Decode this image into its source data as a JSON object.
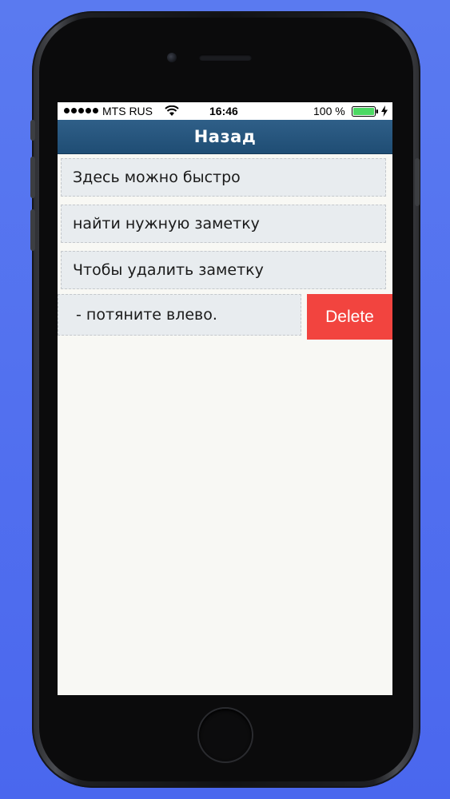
{
  "status_bar": {
    "carrier": "MTS RUS",
    "time": "16:46",
    "battery_percent": "100 %",
    "battery_level": 1.0,
    "icons": [
      "signal-dots-icon",
      "wifi-icon",
      "battery-icon",
      "charging-bolt-icon"
    ]
  },
  "nav": {
    "title": "Назад"
  },
  "notes": [
    {
      "text": "Здесь можно быстро"
    },
    {
      "text": "найти нужную заметку"
    },
    {
      "text": "Чтобы удалить заметку"
    },
    {
      "text": "- потяните влево."
    }
  ],
  "swipe": {
    "delete_label": "Delete"
  },
  "colors": {
    "background": "#4a67ee",
    "nav_bar": "#1f4d74",
    "delete": "#f2443f",
    "row": "#e8ecef",
    "battery": "#4cd964"
  }
}
